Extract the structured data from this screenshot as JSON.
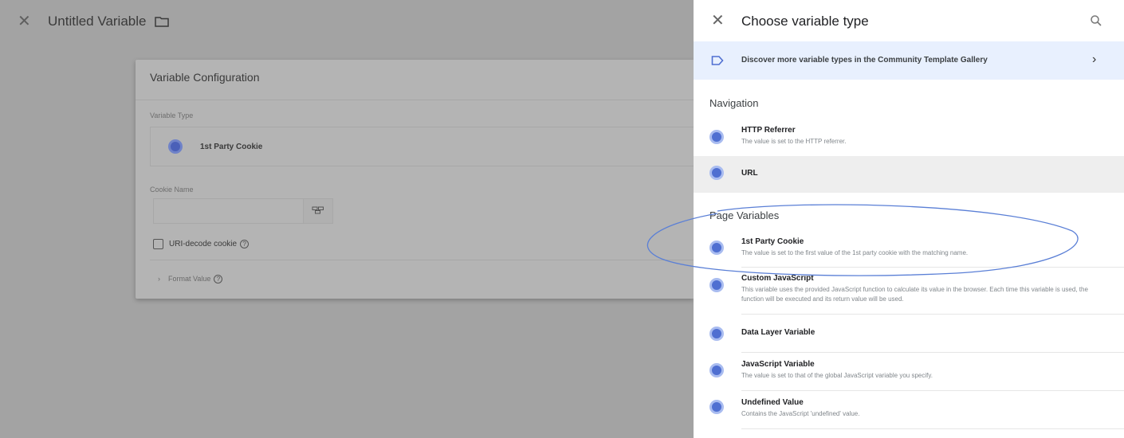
{
  "editor": {
    "title": "Untitled Variable",
    "card_title": "Variable Configuration",
    "type_label": "Variable Type",
    "selected_type": "1st Party Cookie",
    "cookie_name_label": "Cookie Name",
    "cookie_name_value": "",
    "uri_decode_label": "URI-decode cookie",
    "format_value_label": "Format Value"
  },
  "panel": {
    "title": "Choose variable type",
    "gallery_text": "Discover more variable types in the Community Template Gallery",
    "sections": [
      {
        "header": "Navigation",
        "items": [
          {
            "name": "HTTP Referrer",
            "description": "The value is set to the HTTP referrer."
          },
          {
            "name": "URL",
            "description": ""
          }
        ]
      },
      {
        "header": "Page Variables",
        "items": [
          {
            "name": "1st Party Cookie",
            "description": "The value is set to the first value of the 1st party cookie with the matching name."
          },
          {
            "name": "Custom JavaScript",
            "description": "This variable uses the provided JavaScript function to calculate its value in the browser. Each time this variable is used, the function will be executed and its return value will be used."
          },
          {
            "name": "Data Layer Variable",
            "description": ""
          },
          {
            "name": "JavaScript Variable",
            "description": "The value is set to that of the global JavaScript variable you specify."
          },
          {
            "name": "Undefined Value",
            "description": "Contains the JavaScript 'undefined' value."
          }
        ]
      }
    ]
  },
  "colors": {
    "accent": "#4f6fd1",
    "banner_bg": "#e8f0fe",
    "overlay": "#a3a3a3",
    "highlight_ring": "#5a7fd6"
  }
}
